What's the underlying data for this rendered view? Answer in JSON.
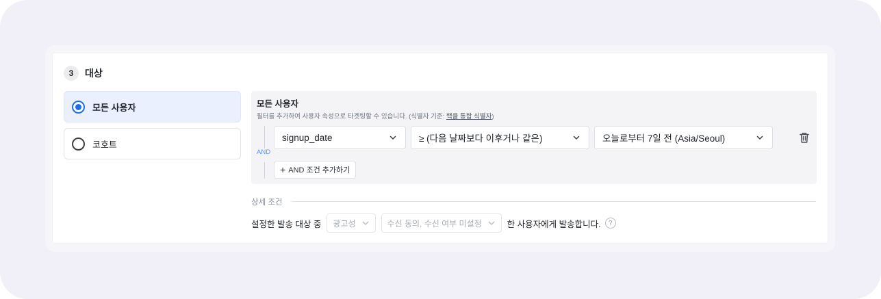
{
  "section": {
    "step": "3",
    "title": "대상"
  },
  "target_options": [
    {
      "label": "모든 사용자",
      "selected": true
    },
    {
      "label": "코호트",
      "selected": false
    }
  ],
  "filter_panel": {
    "title": "모든 사용자",
    "description": "필터를 추가하여 사용자 속성으로 타겟팅할 수 있습니다. (식별자 기준: ",
    "description_link": "핵클 통합 식별자",
    "description_end": ")",
    "and_label": "AND",
    "filter": {
      "property": "signup_date",
      "operator": "≥ (다음 날짜보다 이후거나 같은)",
      "value": "오늘로부터 7일 전 (Asia/Seoul)"
    },
    "add_button_label": "AND 조건 추가하기",
    "icons": {
      "delete": "trash-icon",
      "dropdown": "chevron-down-icon",
      "add": "plus-icon"
    }
  },
  "detail": {
    "label": "상세 조건",
    "sentence_prefix": "설정한 발송 대상 중",
    "ad_select": "광고성",
    "consent_select": "수신 동의, 수신 여부 미설정",
    "sentence_suffix": "한 사용자에게 발송합니다.",
    "help_glyph": "?"
  },
  "colors": {
    "accent": "#1f6bf0",
    "selected_bg": "#eaf0fd",
    "and_label": "#5b8ff5",
    "panel_bg": "#f4f4f6"
  }
}
